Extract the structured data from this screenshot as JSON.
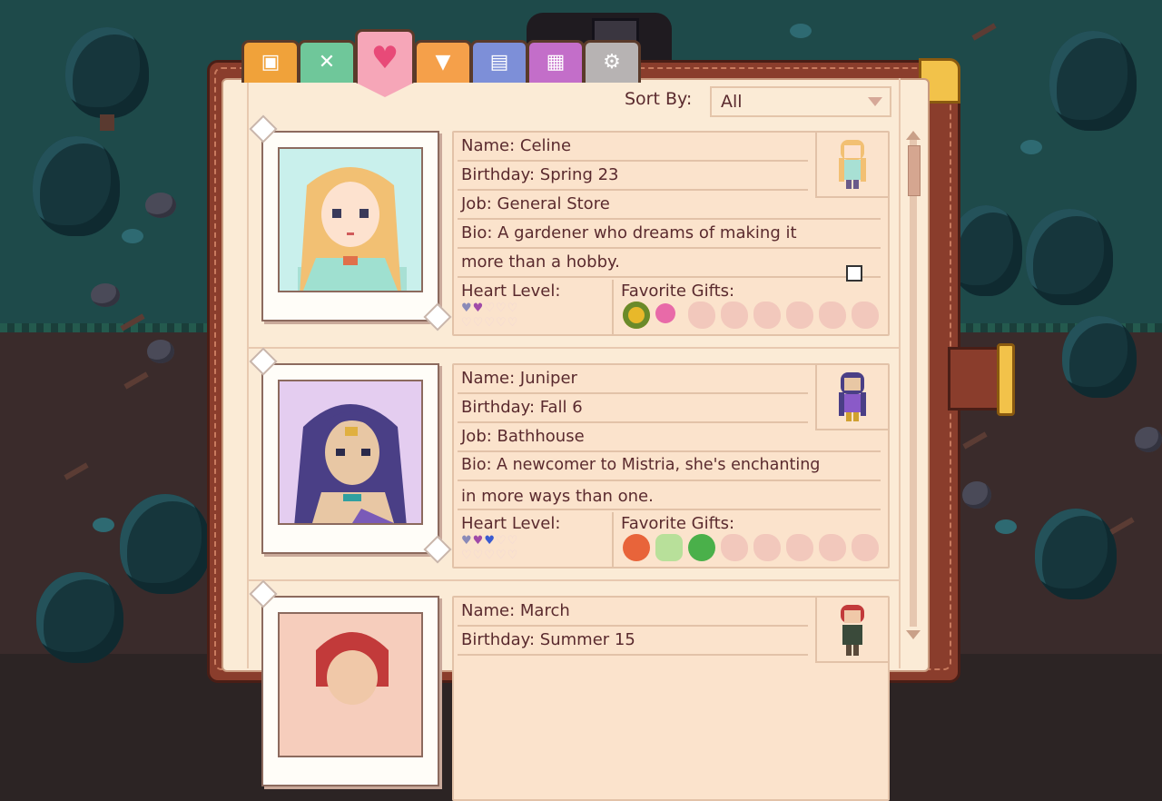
{
  "tabs": [
    {
      "name": "tab-inventory",
      "icon": "backpack-icon",
      "color": "#f0a23a",
      "glyph": "▣"
    },
    {
      "name": "tab-skills",
      "icon": "tools-icon",
      "color": "#6fc79a",
      "glyph": "✕"
    },
    {
      "name": "tab-relationships",
      "icon": "heart-icon",
      "color": "#f6a6b8",
      "glyph": "♥",
      "active": true
    },
    {
      "name": "tab-quests",
      "icon": "hammer-icon",
      "color": "#f5a04a",
      "glyph": "▼"
    },
    {
      "name": "tab-journal",
      "icon": "book-icon",
      "color": "#7d8fd8",
      "glyph": "▤"
    },
    {
      "name": "tab-map",
      "icon": "map-icon",
      "color": "#c36ec9",
      "glyph": "▦"
    },
    {
      "name": "tab-settings",
      "icon": "gear-icon",
      "color": "#b7b3b3",
      "glyph": "⚙"
    }
  ],
  "sort": {
    "label": "Sort By:",
    "value": "All"
  },
  "villagers": [
    {
      "name_label": "Name: Celine",
      "birthday_label": "Birthday: Spring 23",
      "job_label": "Job: General Store",
      "bio_line1": "Bio: A gardener who dreams of making it",
      "bio_line2": "more than a hobby.",
      "heart_label": "Heart Level:",
      "gifts_label": "Favorite Gifts:",
      "hearts_filled": 2,
      "hearts_total": 10,
      "portrait_bg": "#c9f0ec",
      "hair": "#f2c073",
      "gifts": [
        "sunflower-icon",
        "rose-icon"
      ]
    },
    {
      "name_label": "Name: Juniper",
      "birthday_label": "Birthday: Fall 6",
      "job_label": "Job: Bathhouse",
      "bio_line1": "Bio: A newcomer to Mistria, she's enchanting",
      "bio_line2": "in more ways than one.",
      "heart_label": "Heart Level:",
      "gifts_label": "Favorite Gifts:",
      "hearts_filled": 3,
      "hearts_total": 10,
      "portrait_bg": "#e4cdf0",
      "hair": "#4a3f86",
      "gifts": [
        "pumpkin-icon",
        "fennel-icon",
        "snail-shell-icon"
      ]
    },
    {
      "name_label": "Name: March",
      "birthday_label": "Birthday: Summer 15",
      "portrait_bg": "#f6cdbc",
      "hair": "#c23a3a"
    }
  ]
}
